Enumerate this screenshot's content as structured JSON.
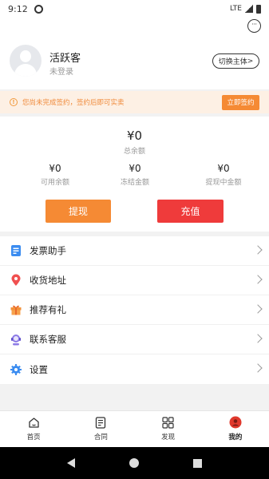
{
  "status_bar": {
    "time": "9:12",
    "network": "LTE"
  },
  "profile": {
    "name": "活跃客",
    "login_status": "未登录",
    "switch_label": "切换主体",
    "switch_arrow": ">"
  },
  "notice": {
    "message": "您尚未完成签约，签约后即可实卖",
    "action_label": "立即签约",
    "color": "#f58a34"
  },
  "balance": {
    "total_value": "¥0",
    "total_label": "总余额",
    "items": [
      {
        "value": "¥0",
        "label": "可用余额"
      },
      {
        "value": "¥0",
        "label": "冻结金额"
      },
      {
        "value": "¥0",
        "label": "提现中金额"
      }
    ],
    "withdraw_label": "提现",
    "recharge_label": "充值",
    "withdraw_color": "#f58a34",
    "recharge_color": "#ef3b3b"
  },
  "menu": [
    {
      "icon": "invoice-icon",
      "label": "发票助手"
    },
    {
      "icon": "location-pin-icon",
      "label": "收货地址"
    },
    {
      "icon": "gift-icon",
      "label": "推荐有礼"
    },
    {
      "icon": "customer-service-icon",
      "label": "联系客服"
    },
    {
      "icon": "gear-icon",
      "label": "设置"
    }
  ],
  "tabs": [
    {
      "icon": "home-icon",
      "label": "首页"
    },
    {
      "icon": "contract-icon",
      "label": "合同"
    },
    {
      "icon": "discover-grid-icon",
      "label": "发现"
    },
    {
      "icon": "profile-icon",
      "label": "我的",
      "active": true
    }
  ]
}
